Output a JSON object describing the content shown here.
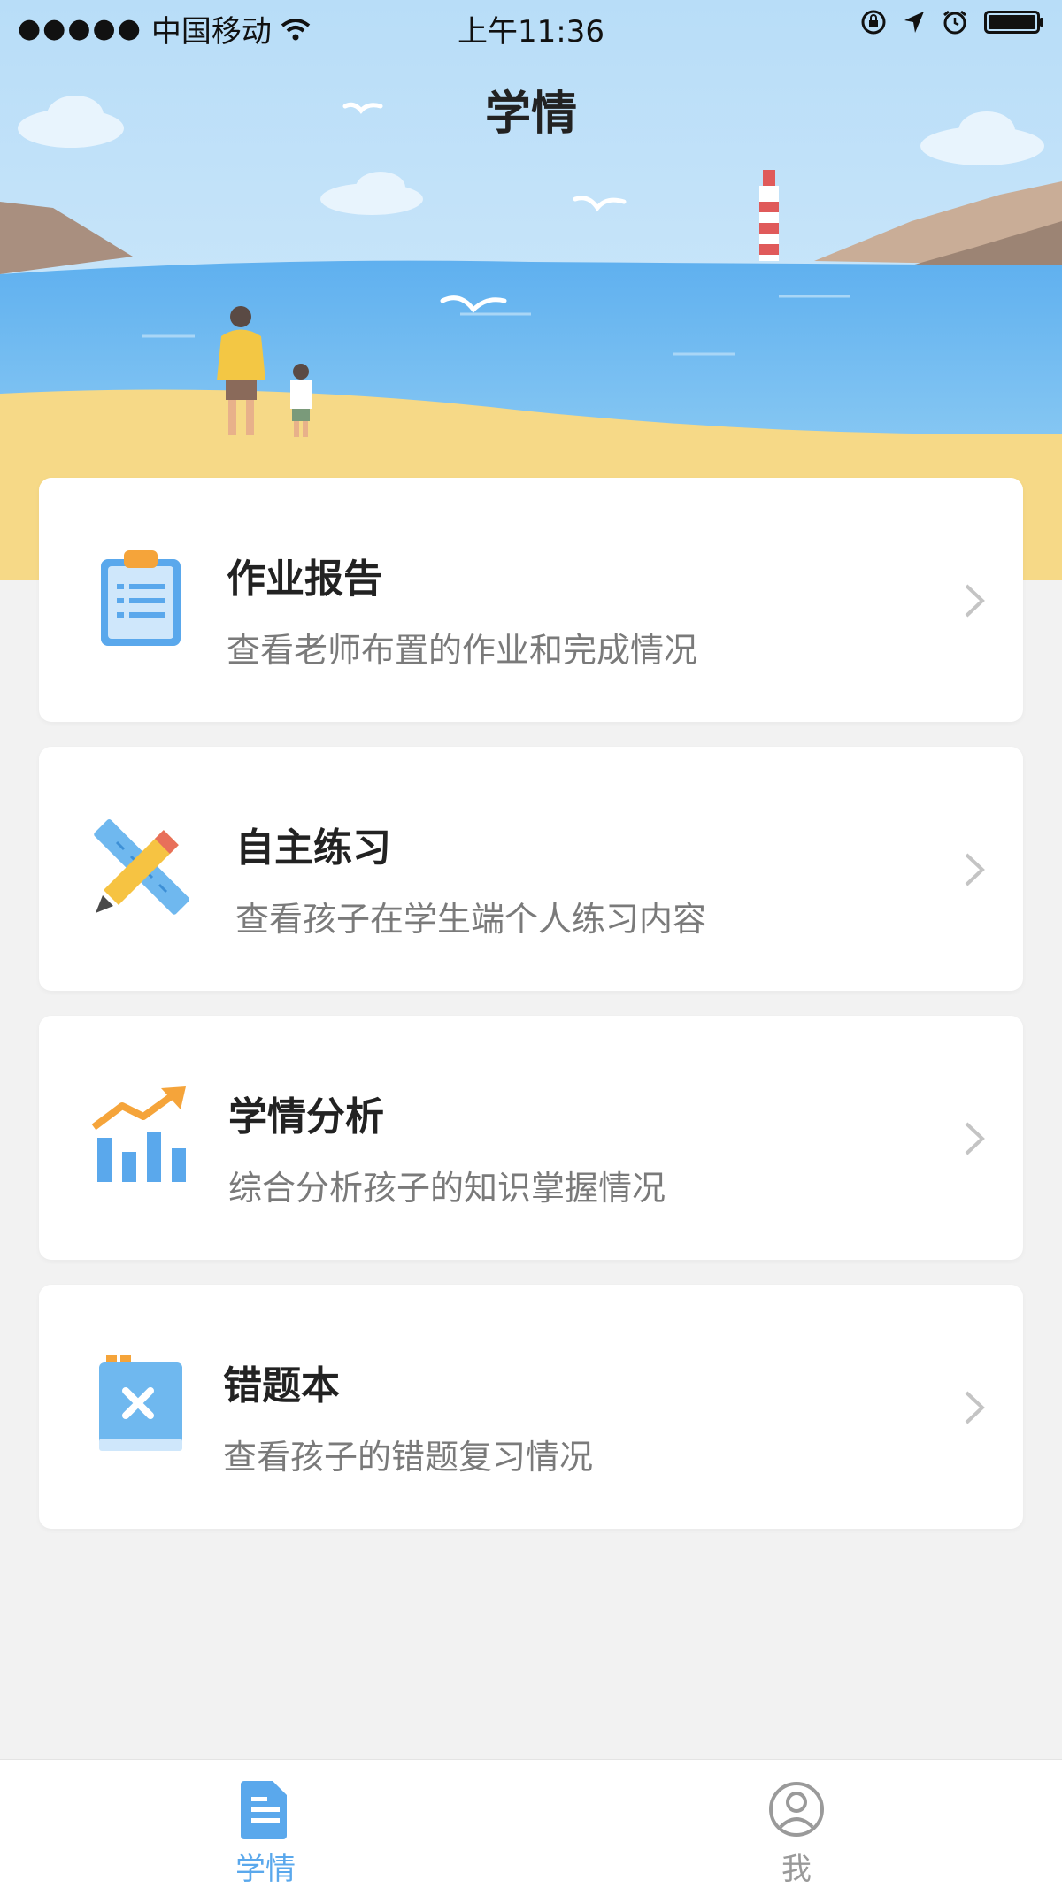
{
  "status_bar": {
    "carrier": "中国移动",
    "time": "上午11:36"
  },
  "header": {
    "title": "学情"
  },
  "cards": [
    {
      "title": "作业报告",
      "desc": "查看老师布置的作业和完成情况",
      "icon": "clipboard-icon"
    },
    {
      "title": "自主练习",
      "desc": "查看孩子在学生端个人练习内容",
      "icon": "pencil-ruler-icon"
    },
    {
      "title": "学情分析",
      "desc": "综合分析孩子的知识掌握情况",
      "icon": "bar-chart-trend-icon"
    },
    {
      "title": "错题本",
      "desc": "查看孩子的错题复习情况",
      "icon": "mistake-book-icon"
    }
  ],
  "tabbar": {
    "items": [
      {
        "label": "学情",
        "icon": "document-icon",
        "active": true
      },
      {
        "label": "我",
        "icon": "user-icon",
        "active": false
      }
    ]
  },
  "colors": {
    "accent": "#5aa8ec",
    "inactive": "#9a9a9a",
    "background": "#f2f2f2"
  }
}
